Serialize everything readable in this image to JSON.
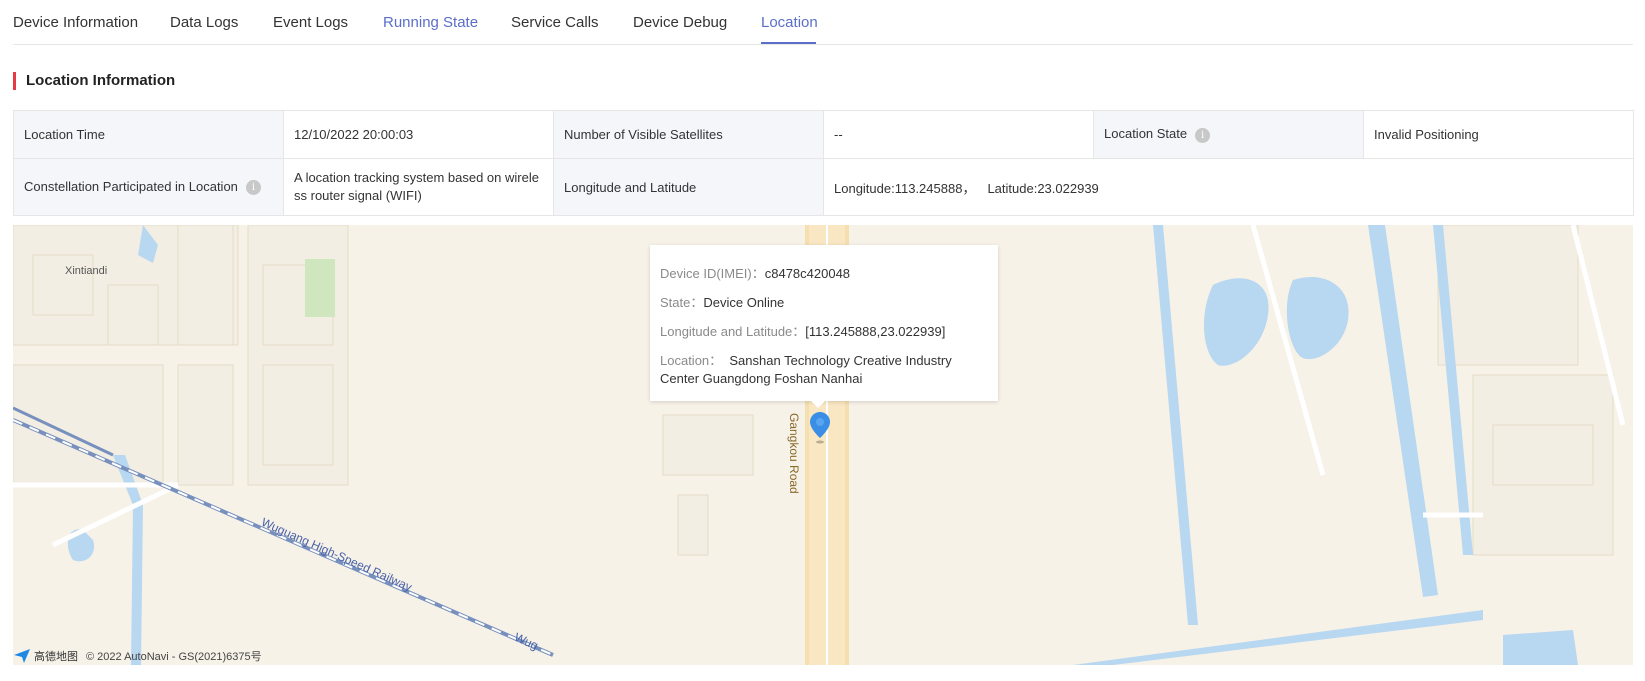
{
  "tabs": [
    {
      "label": "Device Information"
    },
    {
      "label": "Data Logs"
    },
    {
      "label": "Event Logs"
    },
    {
      "label": "Running State"
    },
    {
      "label": "Service Calls"
    },
    {
      "label": "Device Debug"
    },
    {
      "label": "Location"
    }
  ],
  "active_tab": "Location",
  "accent_color": "#5b6fc8",
  "section": {
    "title": "Location Information"
  },
  "info": {
    "location_time_label": "Location Time",
    "location_time_value": "12/10/2022 20:00:03",
    "satellites_label": "Number of Visible Satellites",
    "satellites_value": "--",
    "state_label": "Location State",
    "state_value": "Invalid Positioning",
    "constellation_label": "Constellation Participated in Location",
    "constellation_value": "A location tracking system based on wireless router signal (WIFI)",
    "lnglat_label": "Longitude and Latitude",
    "longitude_text": "Longitude:113.245888，",
    "latitude_text": "Latitude:23.022939"
  },
  "map": {
    "place_label": "Xintiandi",
    "road_label": "Gangkou Road",
    "railway_label": "Wuguang High-Speed Railway",
    "railway_label_tail": "Wug",
    "popup": {
      "device_id_label": "Device ID(IMEI)：",
      "device_id_value": "c8478c420048",
      "state_label": "State：",
      "state_value": "Device Online",
      "lnglat_label": "Longitude and Latitude：",
      "lnglat_value": "[113.245888,23.022939]",
      "location_label": "Location：",
      "location_value": "Sanshan Technology Creative Industry Center Guangdong Foshan Nanhai"
    },
    "attribution_logo": "高德地图",
    "attribution": "© 2022 AutoNavi - GS(2021)6375号"
  }
}
